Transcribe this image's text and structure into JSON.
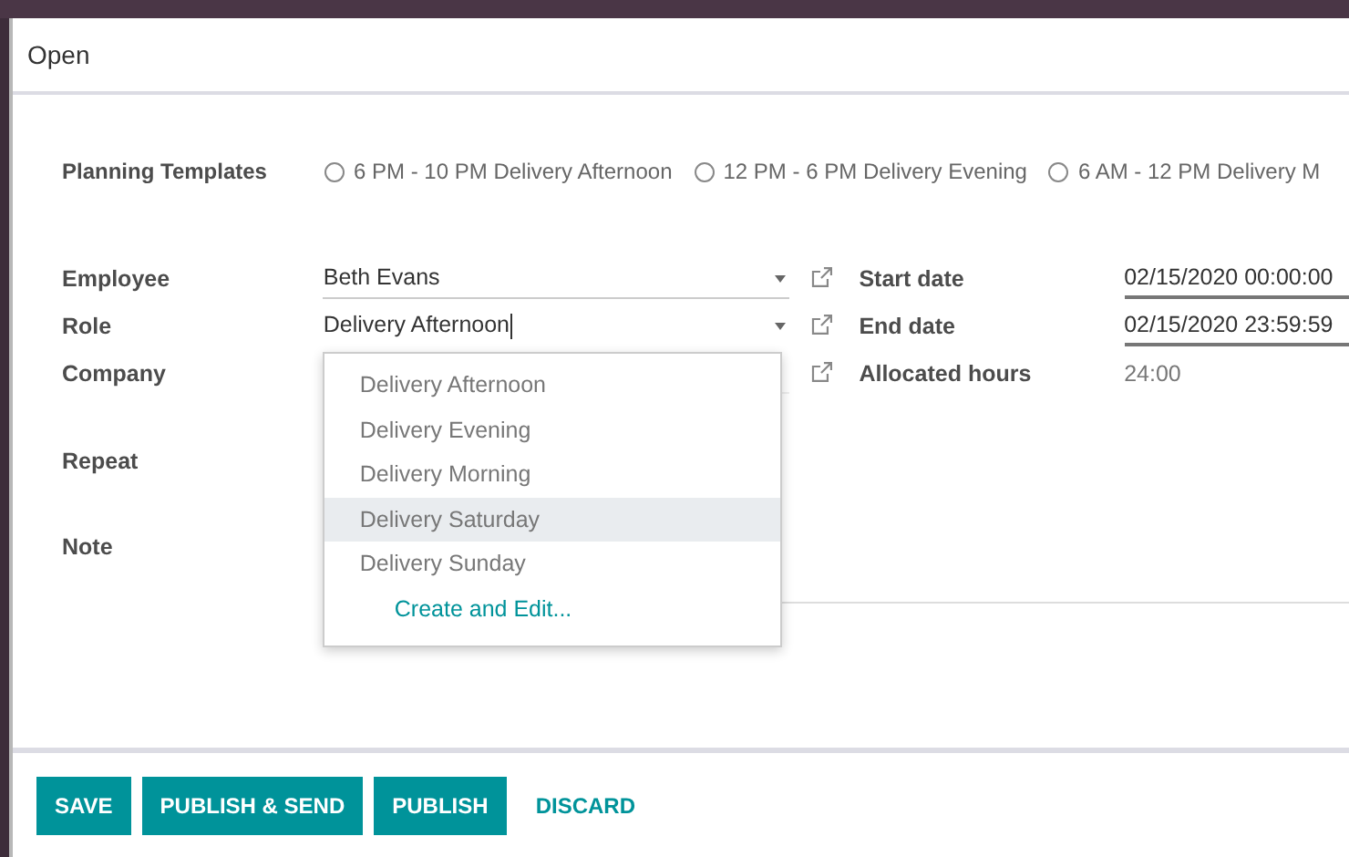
{
  "dialog": {
    "title": "Open"
  },
  "planning_templates": {
    "label": "Planning Templates",
    "options": [
      {
        "label": "6 PM - 10 PM Delivery Afternoon",
        "selected": false
      },
      {
        "label": "12 PM - 6 PM Delivery Evening",
        "selected": false
      },
      {
        "label": "6 AM - 12 PM Delivery M",
        "selected": false
      }
    ]
  },
  "fields_left": [
    {
      "label": "Employee",
      "value": "Beth Evans",
      "focused": false
    },
    {
      "label": "Role",
      "value": "Delivery Afternoon",
      "focused": true
    },
    {
      "label": "Company",
      "focused": false
    }
  ],
  "fields_right": [
    {
      "label": "Start date",
      "value": "02/15/2020 00:00:00",
      "kind": "input"
    },
    {
      "label": "End date",
      "value": "02/15/2020 23:59:59",
      "kind": "input"
    },
    {
      "label": "Allocated hours",
      "value": "24:00",
      "kind": "readonly"
    }
  ],
  "repeat": {
    "label": "Repeat"
  },
  "note": {
    "label": "Note"
  },
  "role_dropdown": {
    "items": [
      {
        "label": "Delivery Afternoon",
        "selected": false
      },
      {
        "label": "Delivery Evening",
        "selected": false
      },
      {
        "label": "Delivery Morning",
        "selected": false
      },
      {
        "label": "Delivery Saturday",
        "selected": true
      },
      {
        "label": "Delivery Sunday",
        "selected": false
      }
    ],
    "create_link": "Create and Edit..."
  },
  "footer_buttons": [
    {
      "label": "SAVE",
      "kind": "primary"
    },
    {
      "label": "PUBLISH & SEND",
      "kind": "primary"
    },
    {
      "label": "PUBLISH",
      "kind": "primary"
    },
    {
      "label": "DISCARD",
      "kind": "link"
    }
  ]
}
